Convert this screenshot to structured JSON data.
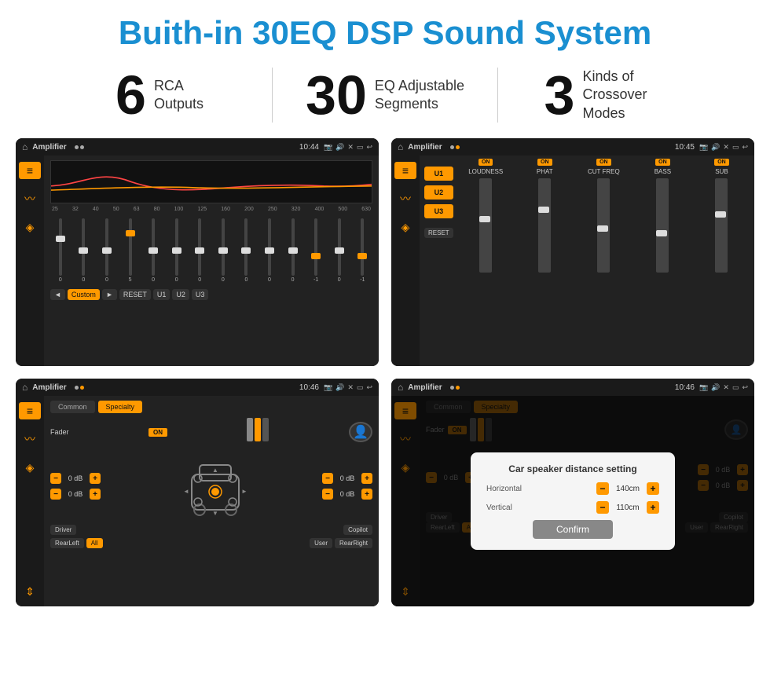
{
  "title": "Buith-in 30EQ DSP Sound System",
  "stats": [
    {
      "number": "6",
      "text": "RCA\nOutputs"
    },
    {
      "number": "30",
      "text": "EQ Adjustable\nSegments"
    },
    {
      "number": "3",
      "text": "Kinds of\nCrossover Modes"
    }
  ],
  "screens": {
    "eq": {
      "title": "Amplifier",
      "time": "10:44",
      "freq_labels": [
        "25",
        "32",
        "40",
        "50",
        "63",
        "80",
        "100",
        "125",
        "160",
        "200",
        "250",
        "320",
        "400",
        "500",
        "630"
      ],
      "values": [
        "0",
        "0",
        "0",
        "5",
        "0",
        "0",
        "0",
        "0",
        "0",
        "0",
        "0",
        "-1",
        "0",
        "-1"
      ],
      "controls": [
        "◄",
        "Custom",
        "►",
        "RESET",
        "U1",
        "U2",
        "U3"
      ]
    },
    "crossover": {
      "title": "Amplifier",
      "time": "10:45",
      "channels": [
        "LOUDNESS",
        "PHAT",
        "CUT FREQ",
        "BASS",
        "SUB"
      ],
      "u_buttons": [
        "U1",
        "U2",
        "U3"
      ]
    },
    "fader": {
      "title": "Amplifier",
      "time": "10:46",
      "tabs": [
        "Common",
        "Specialty"
      ],
      "fader_label": "Fader",
      "fader_on": "ON",
      "db_left_top": "0 dB",
      "db_left_bottom": "0 dB",
      "db_right_top": "0 dB",
      "db_right_bottom": "0 dB",
      "buttons": [
        "Driver",
        "",
        "",
        "",
        "",
        "Copilot",
        "RearLeft",
        "All",
        "",
        "User",
        "RearRight"
      ]
    },
    "dialog": {
      "title": "Amplifier",
      "time": "10:46",
      "dialog_title": "Car speaker distance setting",
      "horizontal_label": "Horizontal",
      "horizontal_value": "140cm",
      "vertical_label": "Vertical",
      "vertical_value": "110cm",
      "confirm_label": "Confirm",
      "db_right_top": "0 dB",
      "db_right_bottom": "0 dB",
      "buttons": [
        "Driver",
        "",
        "",
        "Copilot",
        "RearLeft",
        "All",
        "User",
        "RearRight"
      ]
    }
  }
}
